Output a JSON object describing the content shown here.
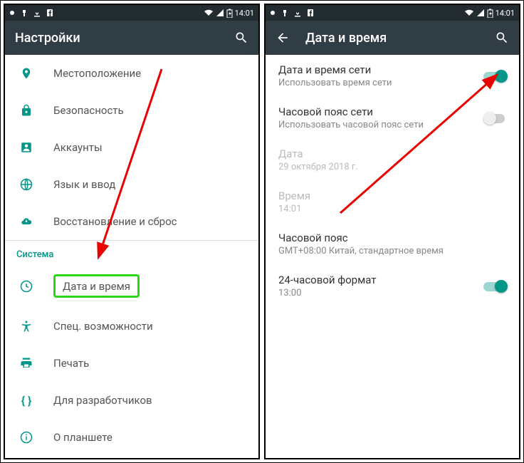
{
  "status": {
    "time": "14:01"
  },
  "left": {
    "appbar_title": "Настройки",
    "items": [
      {
        "label": "Местоположение"
      },
      {
        "label": "Безопасность"
      },
      {
        "label": "Аккаунты"
      },
      {
        "label": "Язык и ввод"
      },
      {
        "label": "Восстановление и сброс"
      }
    ],
    "section": "Система",
    "system_items": [
      {
        "label": "Дата и время"
      },
      {
        "label": "Спец. возможности"
      },
      {
        "label": "Печать"
      },
      {
        "label": "Для разработчиков"
      },
      {
        "label": "О планшете"
      }
    ]
  },
  "right": {
    "appbar_title": "Дата и время",
    "rows": [
      {
        "title": "Дата и время сети",
        "sub": "Использовать время сети",
        "toggle": "on"
      },
      {
        "title": "Часовой пояс сети",
        "sub": "Использовать часовой пояс сети",
        "toggle": "off"
      },
      {
        "title": "Дата",
        "sub": "29 октября 2018 г.",
        "disabled": true
      },
      {
        "title": "Время",
        "sub": "14:01",
        "disabled": true
      },
      {
        "title": "Часовой пояс",
        "sub": "GMT+08:00 Китай, стандартное время"
      },
      {
        "title": "24-часовой формат",
        "sub": "13:00",
        "toggle": "on"
      }
    ]
  }
}
